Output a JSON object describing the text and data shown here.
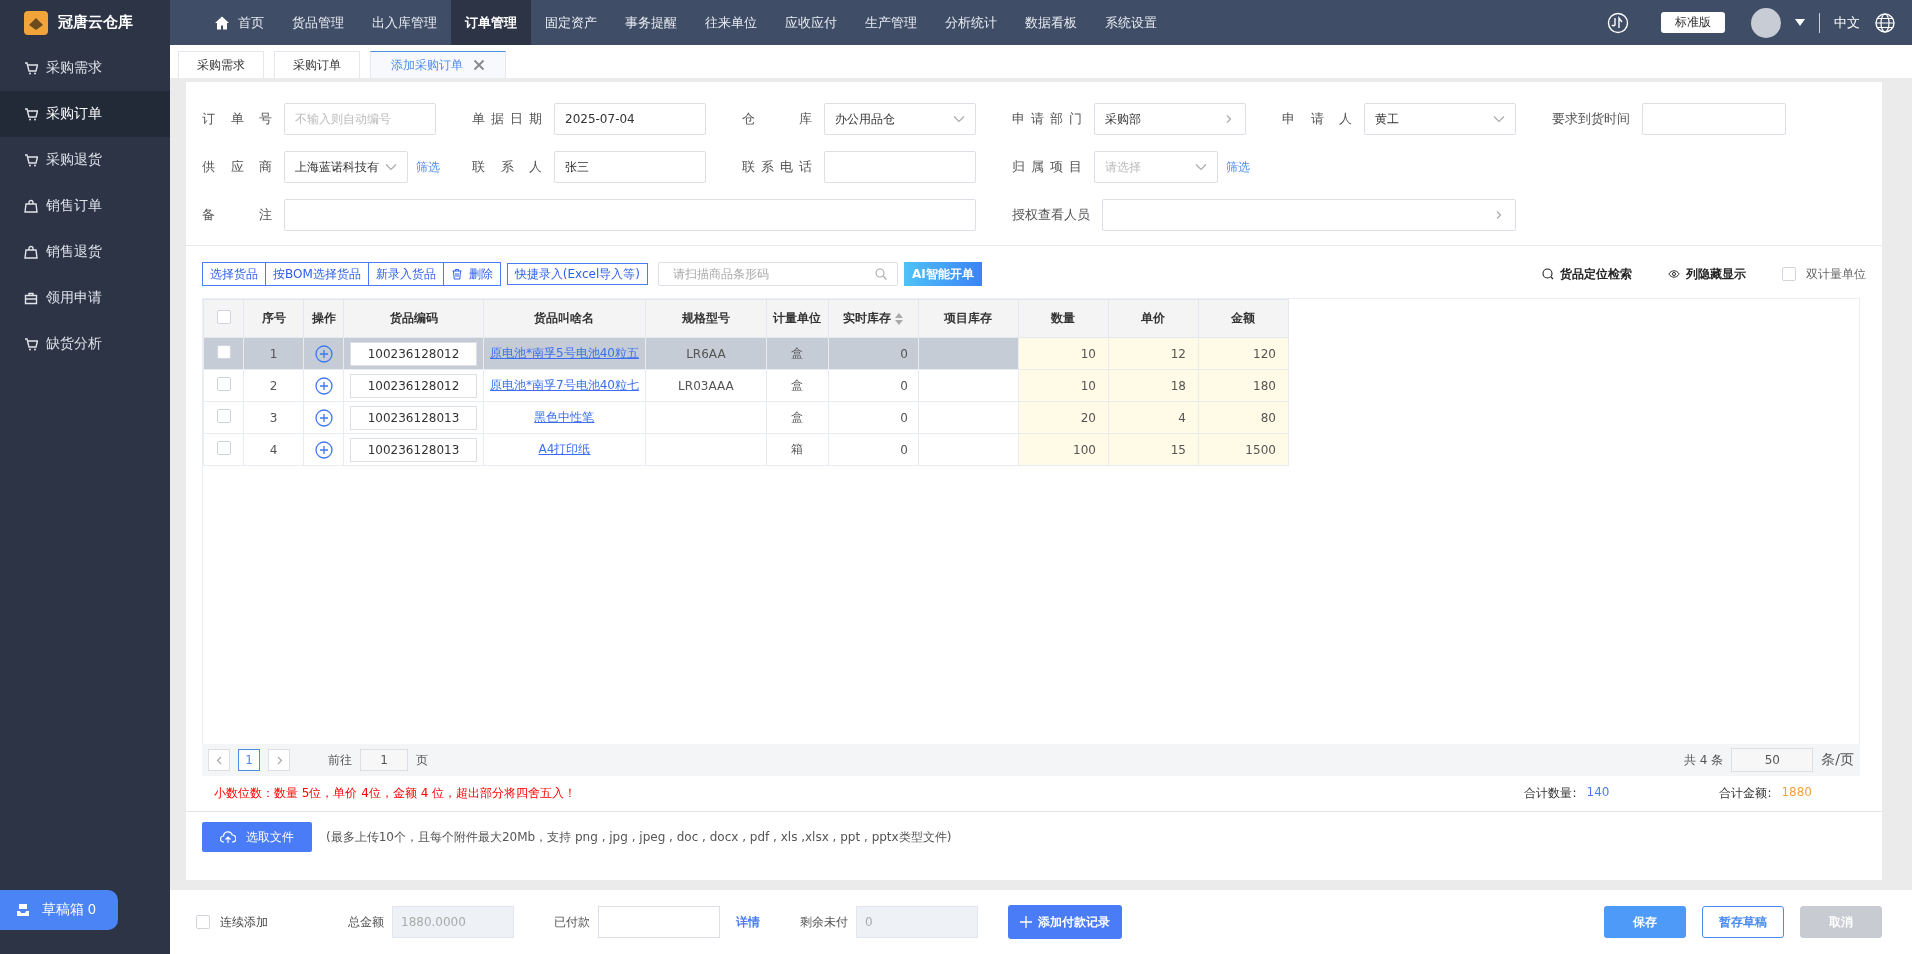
{
  "app": {
    "name": "冠唐云仓库"
  },
  "top_nav": [
    {
      "label": "首页",
      "selected": false
    },
    {
      "label": "货品管理",
      "selected": false
    },
    {
      "label": "出入库管理",
      "selected": false
    },
    {
      "label": "订单管理",
      "selected": true
    },
    {
      "label": "固定资产",
      "selected": false
    },
    {
      "label": "事务提醒",
      "selected": false
    },
    {
      "label": "往来单位",
      "selected": false
    },
    {
      "label": "应收应付",
      "selected": false
    },
    {
      "label": "生产管理",
      "selected": false
    },
    {
      "label": "分析统计",
      "selected": false
    },
    {
      "label": "数据看板",
      "selected": false
    },
    {
      "label": "系统设置",
      "selected": false
    }
  ],
  "header_right": {
    "edition": "标准版",
    "language": "中文"
  },
  "sidebar": {
    "items": [
      {
        "label": "采购需求",
        "selected": false
      },
      {
        "label": "采购订单",
        "selected": true
      },
      {
        "label": "采购退货",
        "selected": false
      },
      {
        "label": "销售订单",
        "selected": false
      },
      {
        "label": "销售退货",
        "selected": false
      },
      {
        "label": "领用申请",
        "selected": false
      },
      {
        "label": "缺货分析",
        "selected": false
      }
    ],
    "drafts": {
      "label": "草稿箱",
      "count": "0"
    }
  },
  "tabs": [
    {
      "label": "采购需求",
      "selected": false
    },
    {
      "label": "采购订单",
      "selected": false
    },
    {
      "label": "添加采购订单",
      "selected": true,
      "closable": true
    }
  ],
  "form": {
    "rows": [
      [
        {
          "label": "订单号",
          "kind": "text",
          "placeholder": "不输入则自动编号"
        },
        {
          "label": "单据日期",
          "kind": "text",
          "value": "2025-07-04"
        },
        {
          "label": "仓库",
          "kind": "select",
          "value": "办公用品仓"
        },
        {
          "label": "申请部门",
          "kind": "picker",
          "value": "采购部"
        },
        {
          "label": "申请人",
          "kind": "select",
          "value": "黄工"
        },
        {
          "label": "要求到货时间",
          "kind": "text"
        }
      ],
      [
        {
          "label": "供应商",
          "kind": "select",
          "value": "上海蓝诺科技有",
          "link": "筛选"
        },
        {
          "label": "联系人",
          "kind": "text",
          "value": "张三"
        },
        {
          "label": "联系电话",
          "kind": "text"
        },
        {
          "label": "归属项目",
          "kind": "select",
          "placeholder": "请选择",
          "link": "筛选"
        }
      ],
      [
        {
          "label": "备注",
          "kind": "text"
        },
        "",
        "",
        {
          "label": "授权查看人员",
          "kind": "picker"
        },
        ""
      ]
    ]
  },
  "toolbar": {
    "buttons": [
      {
        "label": "选择货品"
      },
      {
        "label": "按BOM选择货品"
      },
      {
        "label": "新录入货品"
      },
      {
        "label": "删除"
      }
    ],
    "quick_entry": "快捷录入(Excel导入等)",
    "scan_placeholder": "请扫描商品条形码",
    "ai_button": "AI智能开单",
    "locate": "货品定位检索",
    "columns_toggle": "列隐藏显示",
    "dual_unit": {
      "label": "双计量单位",
      "checked": false
    }
  },
  "table": {
    "select_all": {
      "checked": false
    },
    "columns": [
      {
        "label": "序号"
      },
      {
        "label": "操作"
      },
      {
        "label": "货品编码"
      },
      {
        "label": "货品叫啥名"
      },
      {
        "label": "规格型号"
      },
      {
        "label": "计量单位"
      },
      {
        "label": "实时库存",
        "sortable": true
      },
      {
        "label": "项目库存"
      },
      {
        "label": "数量"
      },
      {
        "label": "单价"
      },
      {
        "label": "金额"
      }
    ],
    "rows": [
      {
        "selected": true,
        "checked": false,
        "no": "1",
        "code": "100236128012",
        "name": "原电池*南孚5号电池40粒五",
        "spec": "LR6AA",
        "unit": "盒",
        "stock": "0",
        "qty": "10",
        "price": "12",
        "amount": "120"
      },
      {
        "selected": false,
        "checked": false,
        "no": "2",
        "code": "100236128012",
        "name": "原电池*南孚7号电池40粒七",
        "spec": "LR03AAA",
        "unit": "盒",
        "stock": "0",
        "qty": "10",
        "price": "18",
        "amount": "180"
      },
      {
        "selected": false,
        "checked": false,
        "no": "3",
        "code": "100236128013",
        "name": "黑色中性笔",
        "unit": "盒",
        "stock": "0",
        "qty": "20",
        "price": "4",
        "amount": "80"
      },
      {
        "selected": false,
        "checked": false,
        "no": "4",
        "code": "100236128013",
        "name": "A4打印纸",
        "unit": "箱",
        "stock": "0",
        "qty": "100",
        "price": "15",
        "amount": "1500"
      }
    ]
  },
  "pagination": {
    "pages": [
      {
        "label": "1",
        "selected": true
      }
    ],
    "goto_label": "前往",
    "goto_value": "1",
    "page_suffix": "页",
    "total": "共 4 条",
    "page_size": "50",
    "page_size_suffix": "条/页"
  },
  "summary": {
    "note": "小数位数：数量 5位，单价 4位，金额 4 位，超出部分将四舍五入！",
    "qty_label": "合计数量:",
    "qty": "140",
    "amount_label": "合计金额:",
    "amount": "1880"
  },
  "upload": {
    "button": "选取文件",
    "hint": "(最多上传10个，且每个附件最大20Mb，支持 png , jpg , jpeg , doc , docx , pdf , xls ,xlsx , ppt , pptx类型文件)"
  },
  "footer": {
    "continuous": {
      "label": "连续添加",
      "checked": false
    },
    "fields": [
      {
        "label": "总金额",
        "value": "1880.0000",
        "disabled": true
      },
      {
        "label": "已付款",
        "disabled": false,
        "link": "详情"
      },
      {
        "label": "剩余未付",
        "value": "0",
        "disabled": true
      }
    ],
    "add_payment": "添加付款记录",
    "buttons": [
      {
        "label": "保存",
        "kind": "primary",
        "disabled": false
      },
      {
        "label": "暂存草稿",
        "kind": "outline",
        "disabled": false
      },
      {
        "label": "取消",
        "kind": "plain",
        "disabled": true
      }
    ]
  }
}
